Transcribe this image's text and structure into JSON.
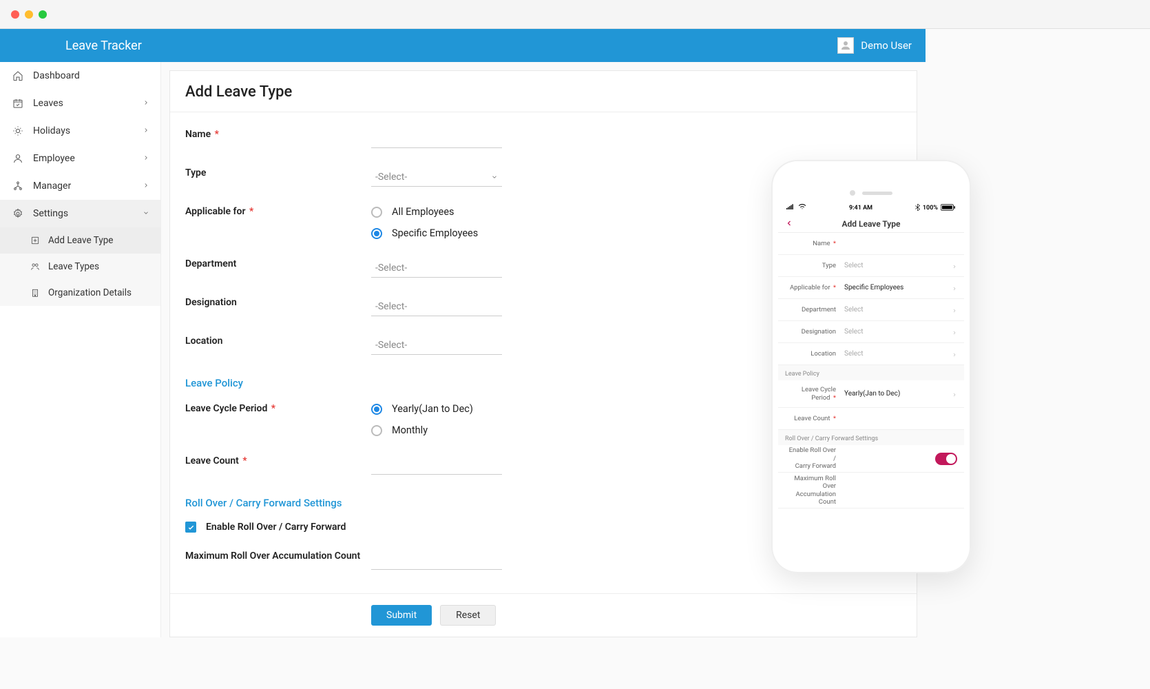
{
  "app": {
    "title": "Leave Tracker",
    "user": "Demo User"
  },
  "sidebar": {
    "items": [
      {
        "label": "Dashboard"
      },
      {
        "label": "Leaves"
      },
      {
        "label": "Holidays"
      },
      {
        "label": "Employee"
      },
      {
        "label": "Manager"
      },
      {
        "label": "Settings"
      }
    ],
    "subitems": [
      {
        "label": "Add Leave Type"
      },
      {
        "label": "Leave Types"
      },
      {
        "label": "Organization Details"
      }
    ]
  },
  "form": {
    "title": "Add Leave Type",
    "labels": {
      "name": "Name",
      "type": "Type",
      "applicable_for": "Applicable for",
      "department": "Department",
      "designation": "Designation",
      "location": "Location",
      "leave_cycle": "Leave Cycle Period",
      "leave_count": "Leave Count",
      "max_rollover": "Maximum Roll Over Accumulation Count"
    },
    "placeholders": {
      "select": "-Select-"
    },
    "options": {
      "applicable_all": "All Employees",
      "applicable_specific": "Specific Employees",
      "cycle_yearly": "Yearly(Jan to Dec)",
      "cycle_monthly": "Monthly"
    },
    "sections": {
      "leave_policy": "Leave Policy",
      "rollover": "Roll Over / Carry Forward Settings"
    },
    "checkbox": {
      "enable_rollover": "Enable Roll Over / Carry Forward"
    },
    "buttons": {
      "submit": "Submit",
      "reset": "Reset"
    }
  },
  "phone": {
    "status": {
      "time": "9:41 AM",
      "battery": "100%"
    },
    "title": "Add Leave Type",
    "labels": {
      "name": "Name",
      "type": "Type",
      "applicable_for": "Applicable for",
      "department": "Department",
      "designation": "Designation",
      "location": "Location",
      "leave_cycle1": "Leave Cycle",
      "leave_cycle2": "Period",
      "leave_count": "Leave Count",
      "enable_rollover1": "Enable Roll Over /",
      "enable_rollover2": "Carry Forward",
      "max1": "Maximum Roll",
      "max2": "Over",
      "max3": "Accumulation",
      "max4": "Count"
    },
    "values": {
      "select": "Select",
      "applicable_for": "Specific Employees",
      "leave_cycle": "Yearly(Jan to Dec)"
    },
    "sections": {
      "leave_policy": "Leave Policy",
      "rollover": "Roll Over / Carry Forward Settings"
    }
  }
}
